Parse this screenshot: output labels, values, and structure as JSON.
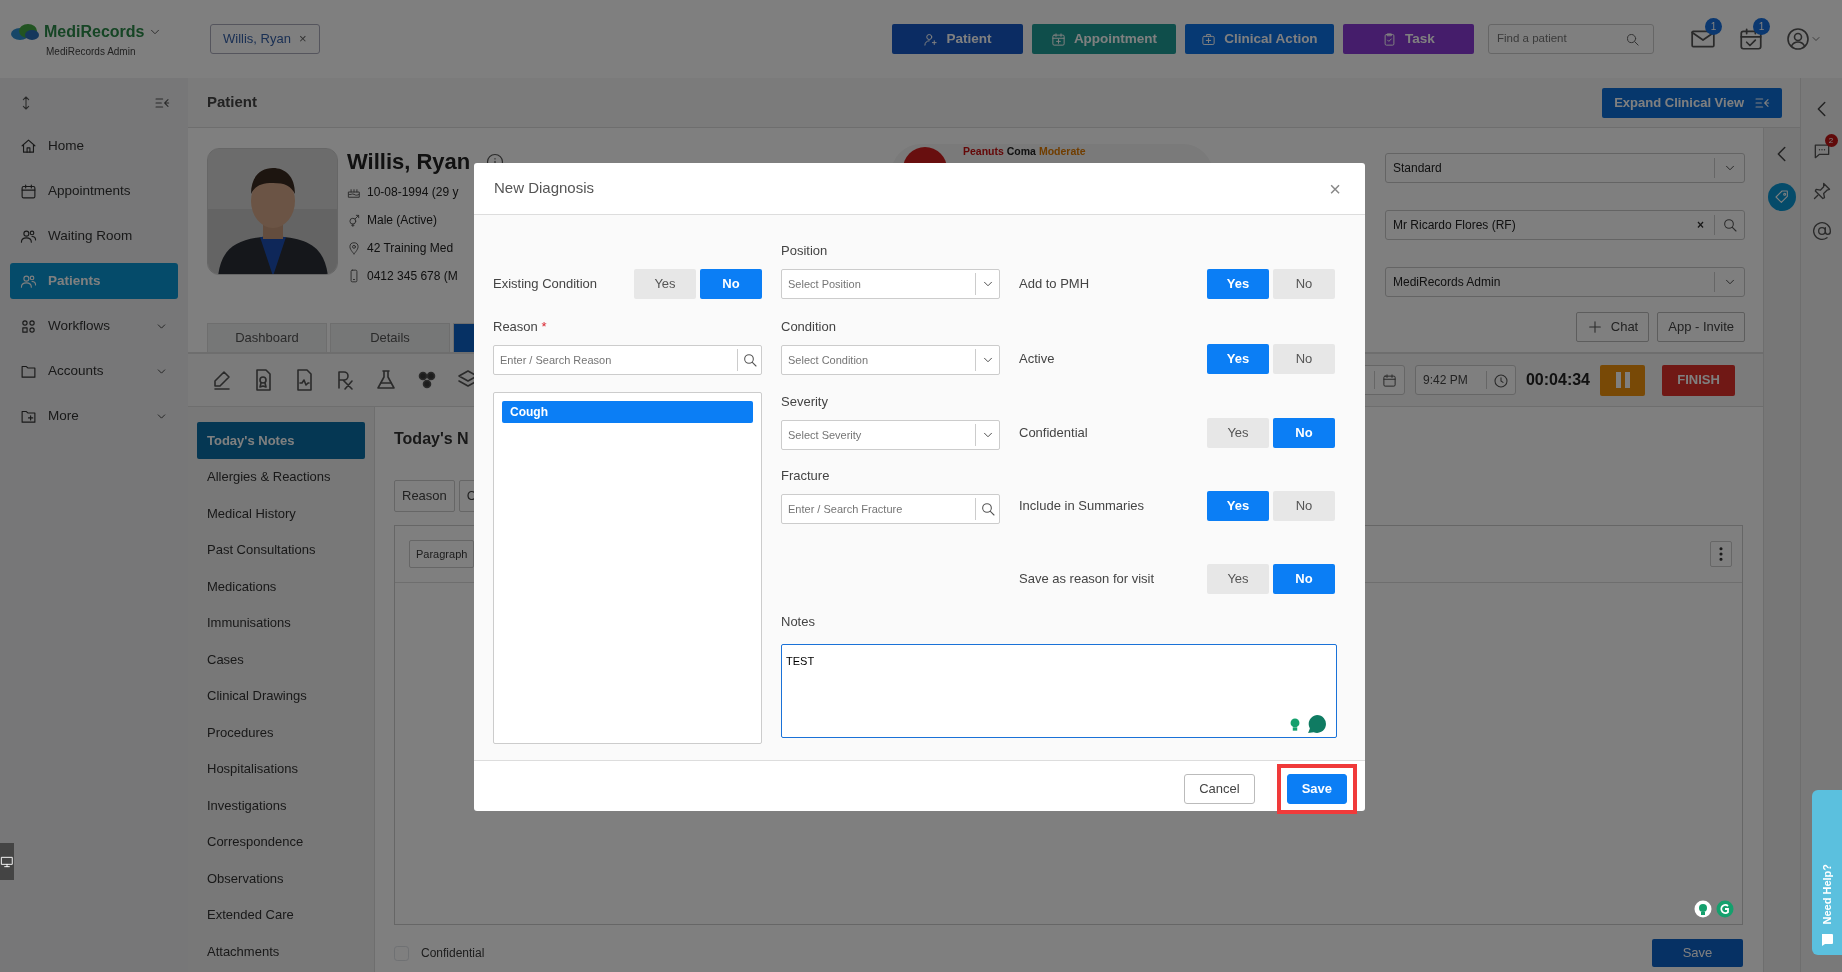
{
  "topbar": {
    "brand": "MediRecords",
    "brand_sub": "MediRecords Admin",
    "patient_tab": {
      "label": "Willis, Ryan",
      "close": "×"
    },
    "actions": [
      {
        "label": "Patient",
        "kind": "patient"
      },
      {
        "label": "Appointment",
        "kind": "appointment"
      },
      {
        "label": "Clinical Action",
        "kind": "clinical"
      },
      {
        "label": "Task",
        "kind": "task"
      }
    ],
    "search": {
      "placeholder": "Find a patient"
    },
    "notifications": [
      {
        "kind": "mail",
        "count": "1"
      },
      {
        "kind": "calendar",
        "count": "1"
      }
    ]
  },
  "sidebar": {
    "items": [
      {
        "label": "Home",
        "kind": "home",
        "selected": false,
        "expandable": false
      },
      {
        "label": "Appointments",
        "kind": "calendar",
        "selected": false,
        "expandable": false
      },
      {
        "label": "Waiting Room",
        "kind": "waiting",
        "selected": false,
        "expandable": false
      },
      {
        "label": "Patients",
        "kind": "patients",
        "selected": true,
        "expandable": false
      },
      {
        "label": "Workflows",
        "kind": "workflows",
        "selected": false,
        "expandable": true
      },
      {
        "label": "Accounts",
        "kind": "folder",
        "selected": false,
        "expandable": true
      },
      {
        "label": "More",
        "kind": "more",
        "selected": false,
        "expandable": true
      }
    ]
  },
  "header": {
    "title": "Patient",
    "expand_button": "Expand Clinical View"
  },
  "patient": {
    "name": "Willis, Ryan",
    "details": [
      {
        "kind": "dob",
        "text": "10-08-1994 (29 y"
      },
      {
        "kind": "gender",
        "text": "Male (Active)"
      },
      {
        "kind": "address",
        "text": "42 Training Med"
      },
      {
        "kind": "phone",
        "text": "0412 345 678 (M"
      }
    ],
    "alert": {
      "allergen": "Peanuts",
      "reaction": "Coma",
      "severity": "Moderate"
    }
  },
  "tabs": [
    {
      "label": "Dashboard",
      "selected": false
    },
    {
      "label": "Details",
      "selected": false
    },
    {
      "selected": true
    }
  ],
  "right_panel": {
    "selects": [
      {
        "value": "Standard",
        "kind": "dropdown"
      },
      {
        "value": "Mr Ricardo Flores (RF)",
        "kind": "search",
        "clear": "×"
      },
      {
        "value": "MediRecords Admin",
        "kind": "dropdown"
      }
    ],
    "buttons": [
      {
        "label": "Chat",
        "kind": "add"
      },
      {
        "label": "App - Invite",
        "kind": "plain"
      }
    ],
    "time": "9:42 PM",
    "timer": "00:04:34",
    "finish": "FINISH"
  },
  "notes_nav": {
    "items": [
      {
        "label": "Today's Notes",
        "selected": true
      },
      {
        "label": "Allergies & Reactions",
        "selected": false
      },
      {
        "label": "Medical History",
        "selected": false
      },
      {
        "label": "Past Consultations",
        "selected": false
      },
      {
        "label": "Medications",
        "selected": false
      },
      {
        "label": "Immunisations",
        "selected": false
      },
      {
        "label": "Cases",
        "selected": false
      },
      {
        "label": "Clinical Drawings",
        "selected": false
      },
      {
        "label": "Procedures",
        "selected": false
      },
      {
        "label": "Hospitalisations",
        "selected": false
      },
      {
        "label": "Investigations",
        "selected": false
      },
      {
        "label": "Correspondence",
        "selected": false
      },
      {
        "label": "Observations",
        "selected": false
      },
      {
        "label": "Extended Care",
        "selected": false
      },
      {
        "label": "Attachments",
        "selected": false
      }
    ]
  },
  "notes": {
    "title": "Today's N",
    "chips": [
      "Reason",
      "C"
    ],
    "editor": {
      "block_style": "Paragraph"
    },
    "confidential": {
      "label": "Confidential",
      "checked": false
    },
    "save": "Save"
  },
  "rail": {
    "chat_badge": "2"
  },
  "help_tab": "Need Help?",
  "modal": {
    "title": "New Diagnosis",
    "close": "×",
    "existing_condition": {
      "label": "Existing Condition",
      "options": [
        {
          "label": "Yes",
          "selected": false
        },
        {
          "label": "No",
          "selected": true
        }
      ]
    },
    "reason": {
      "label": "Reason",
      "required_mark": "*",
      "placeholder": "Enter / Search Reason",
      "items": [
        {
          "label": "Cough",
          "selected": true
        }
      ]
    },
    "fields": [
      {
        "label": "Position",
        "kind": "select",
        "placeholder": "Select Position"
      },
      {
        "label": "Condition",
        "kind": "select",
        "placeholder": "Select Condition"
      },
      {
        "label": "Severity",
        "kind": "select",
        "placeholder": "Select Severity"
      },
      {
        "label": "Fracture",
        "kind": "search",
        "placeholder": "Enter / Search Fracture"
      }
    ],
    "toggles": [
      {
        "label": "Add to PMH",
        "options": [
          {
            "label": "Yes",
            "selected": true
          },
          {
            "label": "No",
            "selected": false
          }
        ]
      },
      {
        "label": "Active",
        "options": [
          {
            "label": "Yes",
            "selected": true
          },
          {
            "label": "No",
            "selected": false
          }
        ]
      },
      {
        "label": "Confidential",
        "options": [
          {
            "label": "Yes",
            "selected": false
          },
          {
            "label": "No",
            "selected": true
          }
        ]
      },
      {
        "label": "Include in Summaries",
        "options": [
          {
            "label": "Yes",
            "selected": true
          },
          {
            "label": "No",
            "selected": false
          }
        ]
      },
      {
        "label": "Save as reason for visit",
        "options": [
          {
            "label": "Yes",
            "selected": false
          },
          {
            "label": "No",
            "selected": true
          }
        ]
      }
    ],
    "notes": {
      "label": "Notes",
      "value": "TEST"
    },
    "buttons": [
      {
        "label": "Cancel",
        "kind": "secondary",
        "highlighted": false
      },
      {
        "label": "Save",
        "kind": "primary",
        "highlighted": true
      }
    ]
  }
}
